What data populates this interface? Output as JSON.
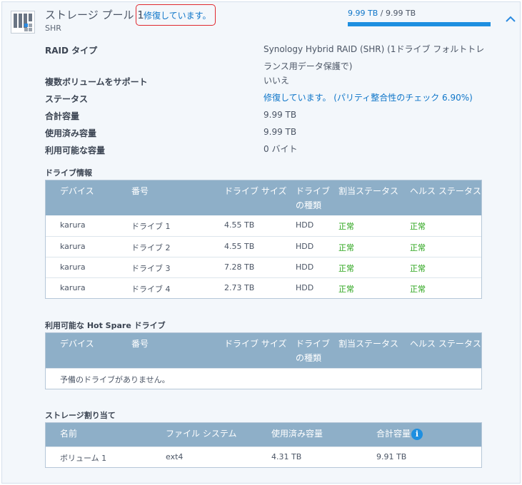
{
  "pool": {
    "title": "ストレージ プール 1",
    "separator": "-",
    "status_link": "修復しています。",
    "subtitle": "SHR",
    "capacity_used": "9.99 TB",
    "capacity_sep": " / ",
    "capacity_total": "9.99 TB",
    "capacity_fraction": 1.0
  },
  "info": [
    {
      "label": "RAID タイプ",
      "value": "Synology Hybrid RAID (SHR) (1ドライブ フォルトトレランス用データ保護で)"
    },
    {
      "label": "複数ボリュームをサポート",
      "value": "いいえ"
    },
    {
      "label": "ステータス",
      "value": "修復しています。 (パリティ整合性のチェック 6.90%)"
    },
    {
      "label": "合計容量",
      "value": "9.99 TB"
    },
    {
      "label": "使用済み容量",
      "value": "9.99 TB"
    },
    {
      "label": "利用可能な容量",
      "value": "0 バイト"
    }
  ],
  "drive_info": {
    "title": "ドライブ情報",
    "headers": [
      "デバイス",
      "番号",
      "ドライブ サイズ",
      "ドライブの種類",
      "割当ステータス",
      "ヘルス ステータス"
    ],
    "rows": [
      [
        "karura",
        "ドライブ 1",
        "4.55 TB",
        "HDD",
        "正常",
        "正常"
      ],
      [
        "karura",
        "ドライブ 2",
        "4.55 TB",
        "HDD",
        "正常",
        "正常"
      ],
      [
        "karura",
        "ドライブ 3",
        "7.28 TB",
        "HDD",
        "正常",
        "正常"
      ],
      [
        "karura",
        "ドライブ 4",
        "2.73 TB",
        "HDD",
        "正常",
        "正常"
      ]
    ]
  },
  "hot_spare": {
    "title": "利用可能な Hot Spare ドライブ",
    "headers": [
      "デバイス",
      "番号",
      "ドライブ サイズ",
      "ドライブの種類",
      "割当ステータス",
      "ヘルス ステータス"
    ],
    "empty_message": "予備のドライブがありません。"
  },
  "allocation": {
    "title": "ストレージ割り当て",
    "headers": [
      "名前",
      "ファイル システム",
      "使用済み容量",
      "合計容量"
    ],
    "rows": [
      [
        "ボリューム 1",
        "ext4",
        "4.31 TB",
        "9.91 TB"
      ]
    ]
  },
  "colors": {
    "accent": "#0f76c9",
    "header_bg": "#8eafc8",
    "ok": "#2aa41a",
    "highlight": "#e0282e"
  },
  "icons": {
    "pool": "storage-pool-icon",
    "collapse": "chevron-up-icon",
    "info": "info-icon"
  }
}
